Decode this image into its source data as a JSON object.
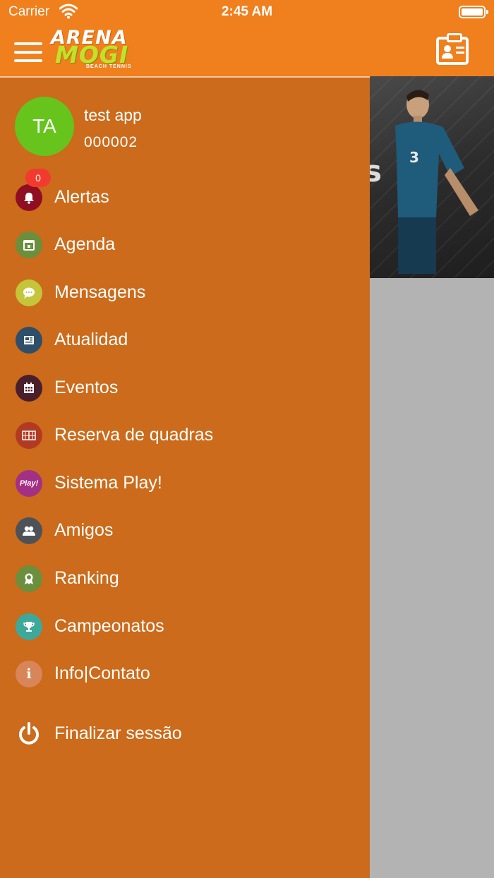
{
  "status_bar": {
    "carrier": "Carrier",
    "time": "2:45 AM"
  },
  "header": {
    "logo_line1": "ARENA",
    "logo_line2": "MOGI",
    "logo_tagline": "BEACH TENNIS",
    "brand_color": "#f07f1e"
  },
  "hero": {
    "partial_text": "s"
  },
  "drawer": {
    "background_color": "#cb6b1b",
    "user": {
      "initials": "TA",
      "name": "test app",
      "code": "000002",
      "avatar_color": "#66c41d"
    },
    "items": [
      {
        "label": "Alertas",
        "icon": "bell-icon",
        "color": "#8f0e22",
        "badge": "0"
      },
      {
        "label": "Agenda",
        "icon": "calendar-icon",
        "color": "#6b8f3c"
      },
      {
        "label": "Mensagens",
        "icon": "chat-bubble-icon",
        "color": "#c5c53a"
      },
      {
        "label": "Atualidad",
        "icon": "newspaper-icon",
        "color": "#2f4e6a"
      },
      {
        "label": "Eventos",
        "icon": "event-calendar-icon",
        "color": "#4a1f2c"
      },
      {
        "label": "Reserva de quadras",
        "icon": "court-icon",
        "color": "#b33a22"
      },
      {
        "label": "Sistema Play!",
        "icon": "play-icon",
        "icon_text": "Play!",
        "color": "#a33084"
      },
      {
        "label": "Amigos",
        "icon": "friends-icon",
        "color": "#4d5259"
      },
      {
        "label": "Ranking",
        "icon": "medal-icon",
        "color": "#6b8f3c"
      },
      {
        "label": "Campeonatos",
        "icon": "trophy-icon",
        "color": "#3ea89a"
      },
      {
        "label": "Info|Contato",
        "icon": "info-icon",
        "icon_text": "i",
        "color": "#d9855a"
      }
    ],
    "logout": {
      "label": "Finalizar sessão",
      "icon": "power-icon"
    }
  }
}
